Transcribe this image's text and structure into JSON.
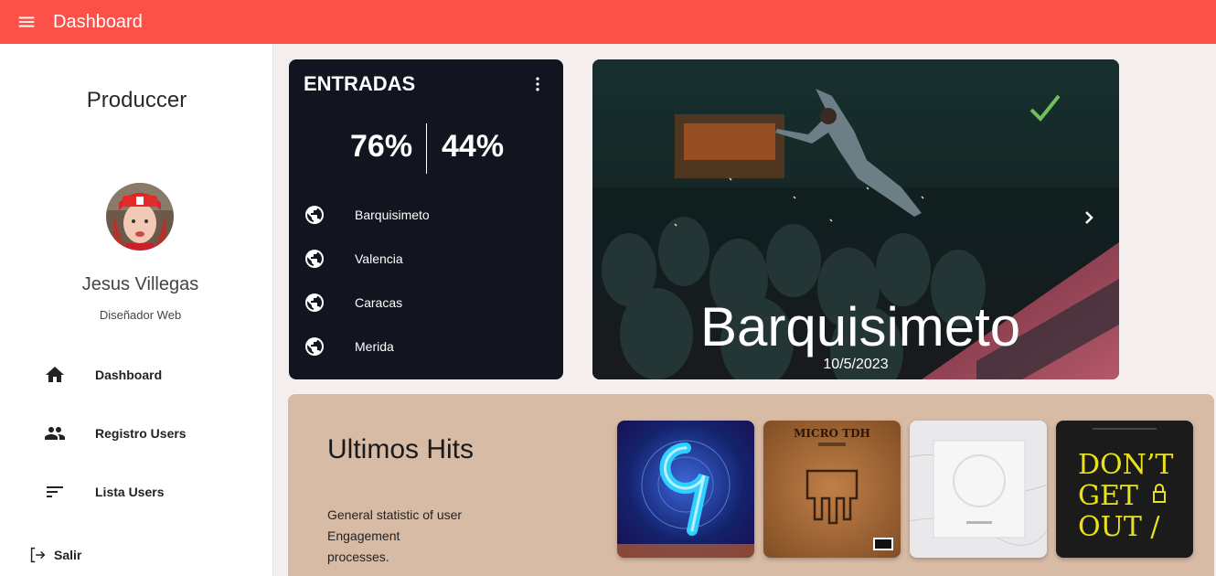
{
  "appbar": {
    "title": "Dashboard",
    "menu_icon": "menu-icon",
    "color": "#fb5149"
  },
  "sidebar": {
    "brand": "Produccer",
    "user": {
      "name": "Jesus Villegas",
      "role": "Diseñador Web"
    },
    "nav": [
      {
        "label": "Dashboard",
        "icon": "home-icon"
      },
      {
        "label": "Registro Users",
        "icon": "people-icon"
      },
      {
        "label": "Lista Users",
        "icon": "sort-icon"
      }
    ],
    "logout": {
      "label": "Salir",
      "icon": "logout-icon"
    }
  },
  "entradas": {
    "title": "ENTRADAS",
    "stat_left": "76%",
    "stat_right": "44%",
    "cities": [
      "Barquisimeto",
      "Valencia",
      "Caracas",
      "Merida"
    ],
    "city_icon": "globe-icon"
  },
  "hero": {
    "city": "Barquisimeto",
    "date": "10/5/2023",
    "next_icon": "chevron-right-icon"
  },
  "hits": {
    "title": "Ultimos Hits",
    "description": "General statistic of user Engagement processes.",
    "albums": [
      {
        "art": "blue-nine-cover"
      },
      {
        "art": "micro-tdh-cover",
        "text": "MICRO TDH"
      },
      {
        "art": "white-marble-cover"
      },
      {
        "art": "dont-get-out-cover",
        "text": "DON'T GET OUT /"
      }
    ]
  }
}
